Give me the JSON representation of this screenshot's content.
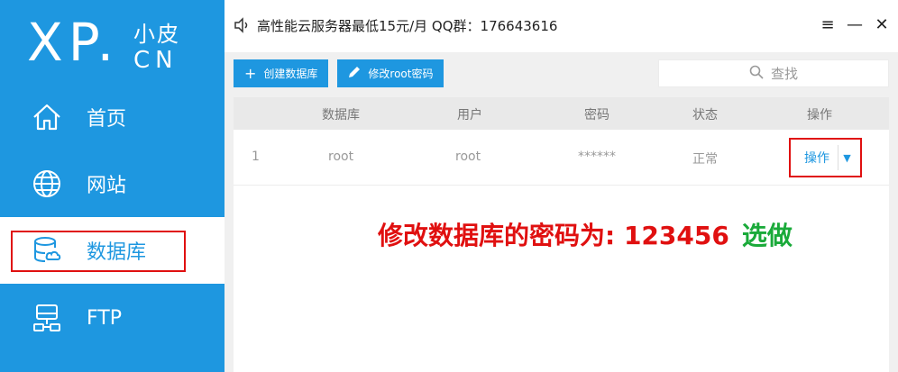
{
  "sidebar": {
    "logo": {
      "main": "XP.",
      "top": "小皮",
      "bottom": "CN"
    },
    "items": [
      {
        "label": "首页",
        "icon": "home-icon"
      },
      {
        "label": "网站",
        "icon": "globe-icon"
      },
      {
        "label": "数据库",
        "icon": "database-icon"
      },
      {
        "label": "FTP",
        "icon": "ftp-icon"
      }
    ],
    "active_index": 2
  },
  "titlebar": {
    "title": "高性能云服务器最低15元/月  QQ群：176643616",
    "controls": [
      "≡",
      "—",
      "✕"
    ]
  },
  "toolbar": {
    "create_label": "创建数据库",
    "change_pwd_label": "修改root密码"
  },
  "search": {
    "placeholder": "查找"
  },
  "table": {
    "columns": [
      "数据库",
      "用户",
      "密码",
      "状态",
      "操作"
    ],
    "rows": [
      {
        "index": "1",
        "database": "root",
        "user": "root",
        "password": "******",
        "status": "正常",
        "action": "操作"
      }
    ]
  },
  "annotation": {
    "red": "修改数据库的密码为: 123456",
    "green": "选做"
  },
  "colors": {
    "accent": "#1e97e0",
    "highlight": "#e01010",
    "green": "#1aaa3a"
  }
}
